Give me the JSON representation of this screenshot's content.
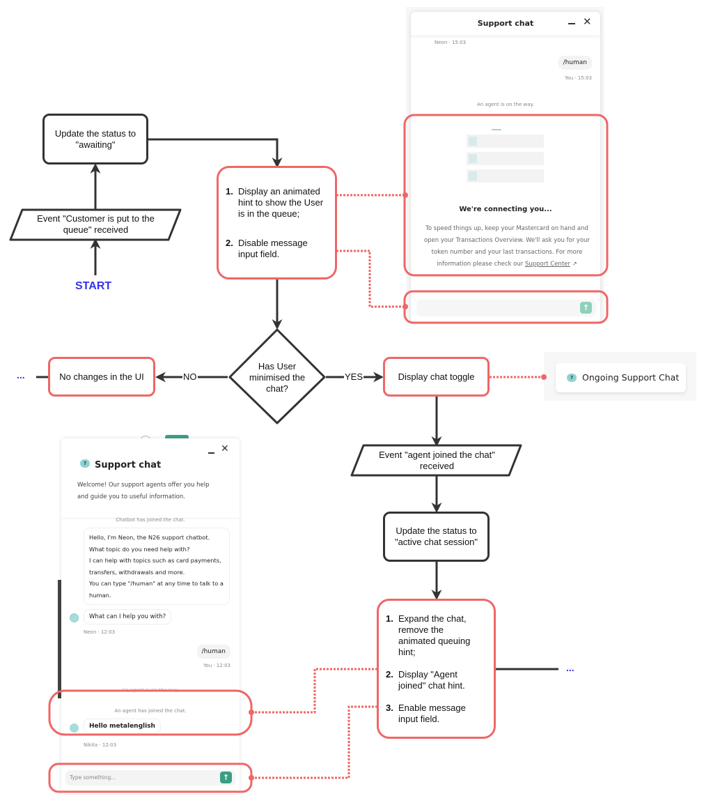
{
  "colors": {
    "process_border": "#333333",
    "ui_border": "#f06666",
    "start": "#3333ee",
    "teal_accent": "#8ed3d1",
    "send_enabled": "#3a9e84",
    "send_disabled": "#8fd1bc"
  },
  "flow": {
    "start_label": "START",
    "event_queue": "Event \"Customer is put to the queue\" received",
    "update_awaiting": "Update the status to \"awaiting\"",
    "queue_actions": [
      {
        "num": "1.",
        "text": "Display an animated hint to show the User is in the queue;"
      },
      {
        "num": "2.",
        "text": "Disable message input field."
      }
    ],
    "decision": "Has User minimised the chat?",
    "no_label": "NO",
    "yes_label": "YES",
    "no_changes": "No changes in the UI",
    "display_toggle": "Display chat toggle",
    "event_agent": "Event \"agent joined the chat\" received",
    "update_active": "Update the status to \"active chat session\"",
    "agent_actions": [
      {
        "num": "1.",
        "text": "Expand the chat, remove the animated queuing hint;"
      },
      {
        "num": "2.",
        "text": "Display \"Agent joined\" chat hint."
      },
      {
        "num": "3.",
        "text": "Enable message input field."
      }
    ],
    "ellipsis_left": "...",
    "ellipsis_right": "..."
  },
  "queue_chat": {
    "title": "Support chat",
    "minimize_icon": "minimize-icon",
    "close_icon": "close-icon",
    "bot_meta": "Neon · 15:03",
    "user_message": "/human",
    "user_meta": "You · 15:03",
    "system_message": "An agent is on the way.",
    "connecting_title": "We're connecting you...",
    "connecting_body": "To speed things up, keep your Mastercard on hand and open your Transactions Overview. We'll ask you for your token number and your last transactions. For more information please check our",
    "support_link": "Support Center",
    "link_icon": "external-link-icon",
    "send_icon": "arrow-up-icon"
  },
  "toggle": {
    "label": "Ongoing Support Chat",
    "icon": "help-bubble-icon",
    "icon_glyph": "?"
  },
  "active_chat": {
    "title": "Support chat",
    "help_glyph": "?",
    "welcome": "Welcome! Our support agents offer you help and guide you to useful information.",
    "chatbot_joined": "Chatbot has joined the chat.",
    "bot_intro": [
      "Hello, I'm Neon, the N26 support chatbot.",
      "What topic do you need help with?",
      "I can help with topics such as card payments, transfers, withdrawals and more.",
      "You can type \"/human\" at any time to talk to a human."
    ],
    "bot_question": "What can I help you with?",
    "bot_meta": "Neon · 12:03",
    "user_message": "/human",
    "user_meta": "You · 12:03",
    "agent_on_way": "An agent is on the way.",
    "agent_joined": "An agent has joined the chat.",
    "agent_message": "Hello metalenglish",
    "agent_meta": "Nikita · 12:03",
    "input_placeholder": "Type something..."
  }
}
